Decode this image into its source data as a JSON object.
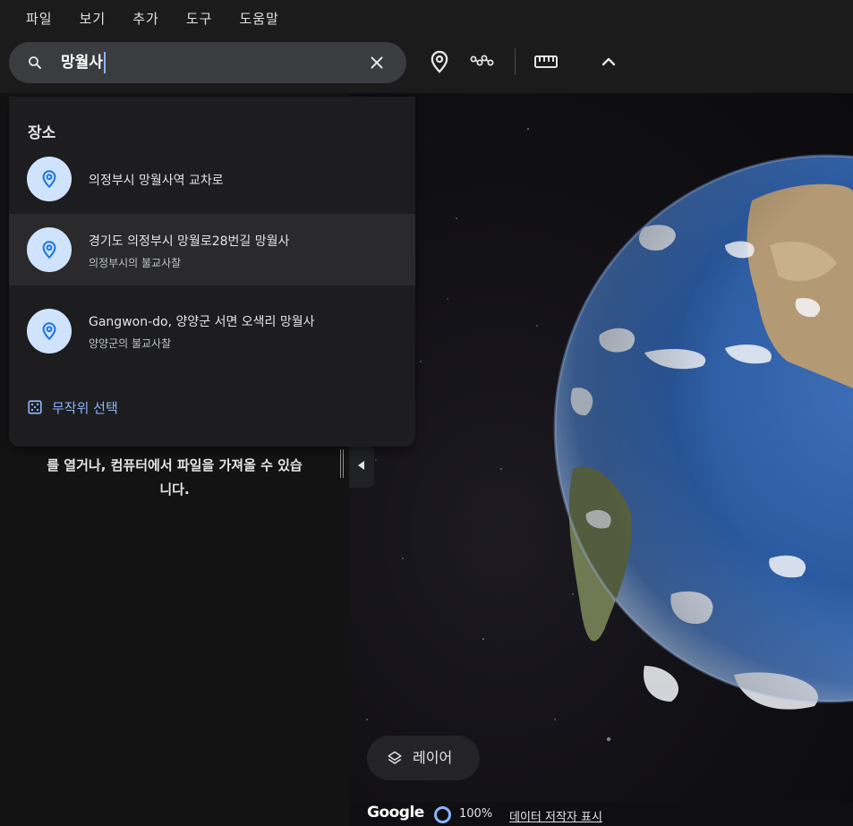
{
  "colors": {
    "accent": "#8ab4f8",
    "pin_bg": "#cfe3fd",
    "pin": "#1a73e8",
    "panel_bg": "#131314",
    "dropdown_bg": "#1d1d1f",
    "highlight_bg": "#2a2a2c"
  },
  "menubar": {
    "items": [
      "파일",
      "보기",
      "추가",
      "도구",
      "도움말"
    ]
  },
  "search": {
    "value": "망월사",
    "search_icon": "search-icon",
    "clear_icon": "close-icon"
  },
  "toolbar": {
    "icons": [
      "place-marker-icon",
      "path-icon",
      "ruler-icon",
      "chevron-up-icon"
    ]
  },
  "dropdown": {
    "heading": "장소",
    "results": [
      {
        "title": "의정부시 망월사역 교차로",
        "subtitle": ""
      },
      {
        "title": "경기도 의정부시 망월로28번길 망월사",
        "subtitle": "의정부시의 불교사찰"
      },
      {
        "title": "Gangwon-do, 양양군 서면 오색리 망월사",
        "subtitle": "양양군의 불교사찰"
      }
    ],
    "random_label": "무작위 선택"
  },
  "leftpanel": {
    "empty_text_line1": "를 열거나, 컴퓨터에서 파일을 가져올 수 있습",
    "empty_text_line2": "니다."
  },
  "globe": {
    "layer_label": "레이어",
    "google_logo": "Google",
    "zoom": "100%",
    "credits": "데이터 저작자 표시"
  }
}
